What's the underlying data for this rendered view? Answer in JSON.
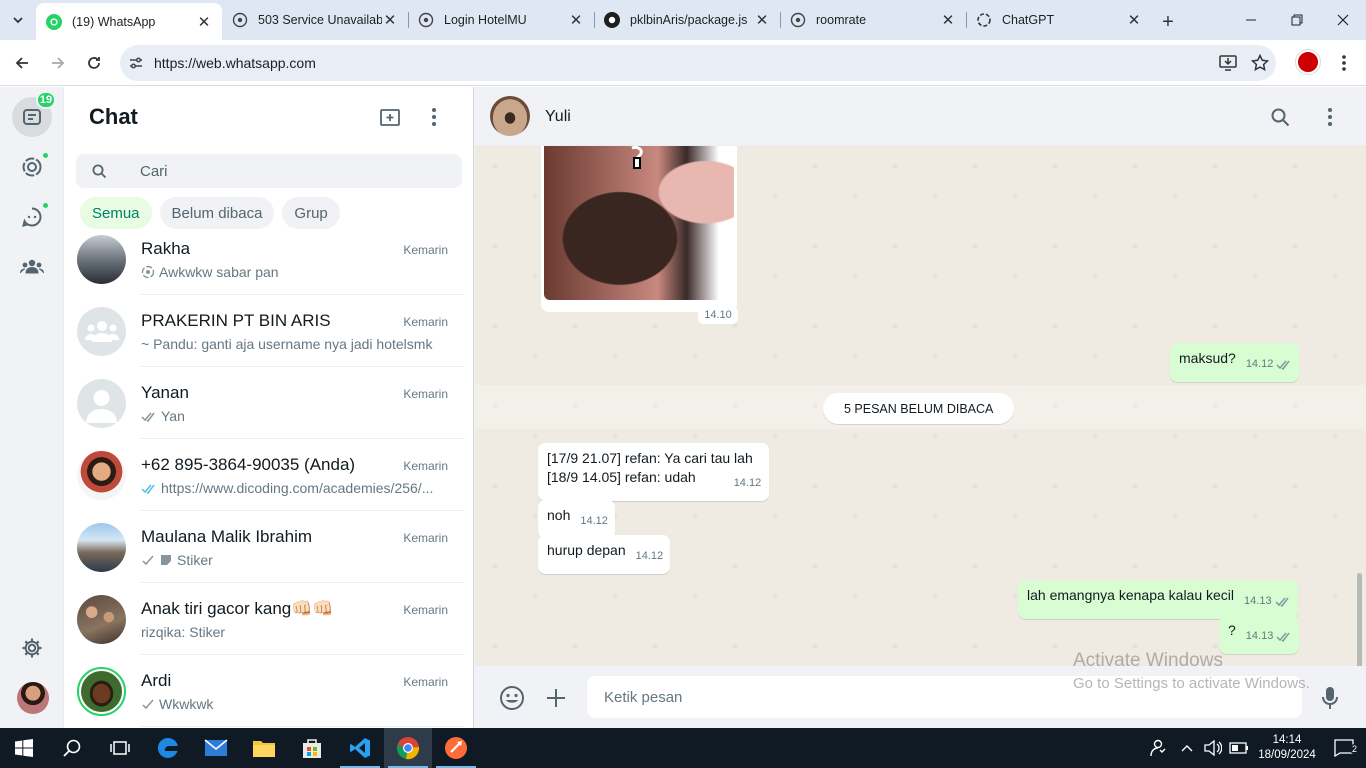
{
  "browser": {
    "tabs": [
      {
        "title": "(19) WhatsApp",
        "favicon": "whatsapp-icon",
        "active": true
      },
      {
        "title": "503 Service Unavailab",
        "favicon": "globe-icon"
      },
      {
        "title": "Login HotelMU",
        "favicon": "globe-icon"
      },
      {
        "title": "pklbinAris/package.js",
        "favicon": "github-icon"
      },
      {
        "title": "roomrate",
        "favicon": "globe-icon"
      },
      {
        "title": "ChatGPT",
        "favicon": "chatgpt-icon"
      }
    ],
    "url": "https://web.whatsapp.com"
  },
  "rail": {
    "unread_badge": "19"
  },
  "sidebar": {
    "title": "Chat",
    "search_placeholder": "Cari",
    "filters": [
      "Semua",
      "Belum dibaca",
      "Grup"
    ],
    "chats": [
      {
        "name": "Rakha",
        "time": "Kemarin",
        "preview": "Awkwkw sabar pan",
        "status": "viewonce-icon"
      },
      {
        "name": "PRAKERIN PT BIN ARIS",
        "time": "Kemarin",
        "preview": "~ Pandu: ganti aja username nya jadi hotelsmk",
        "status": ""
      },
      {
        "name": "Yanan",
        "time": "Kemarin",
        "preview": "Yan",
        "status": "double-check-icon"
      },
      {
        "name": "+62 895-3864-90035 (Anda)",
        "time": "Kemarin",
        "preview": "https://www.dicoding.com/academies/256/...",
        "status": "double-check-blue-icon"
      },
      {
        "name": "Maulana Malik Ibrahim",
        "time": "Kemarin",
        "preview": "Stiker",
        "status": "single-check-icon"
      },
      {
        "name": "Anak tiri gacor kang👊🏻👊🏻",
        "time": "Kemarin",
        "preview": "rizqika: Stiker",
        "status": ""
      },
      {
        "name": "Ardi",
        "time": "Kemarin",
        "preview": "Wkwkwk",
        "status": "single-check-icon"
      }
    ]
  },
  "conversation": {
    "contact": "Yuli",
    "image_time": "14.10",
    "messages": [
      {
        "dir": "out",
        "text": "maksud?",
        "time": "14.12"
      },
      {
        "dir": "in",
        "lines": [
          "[17/9 21.07] refan: Ya cari tau lah",
          "[18/9 14.05] refan: udah"
        ],
        "time": "14.12"
      },
      {
        "dir": "in",
        "text": "noh",
        "time": "14.12"
      },
      {
        "dir": "in",
        "text": "hurup depan",
        "time": "14.12"
      },
      {
        "dir": "out",
        "text": "lah emangnya kenapa kalau kecil",
        "time": "14.13"
      },
      {
        "dir": "out",
        "text": "?",
        "time": "14.13"
      }
    ],
    "unread_divider": "5 PESAN BELUM DIBACA",
    "compose_placeholder": "Ketik pesan"
  },
  "watermark": {
    "line1": "Activate Windows",
    "line2": "Go to Settings to activate Windows."
  },
  "taskbar": {
    "time": "14:14",
    "date": "18/09/2024",
    "notifications": "2"
  }
}
